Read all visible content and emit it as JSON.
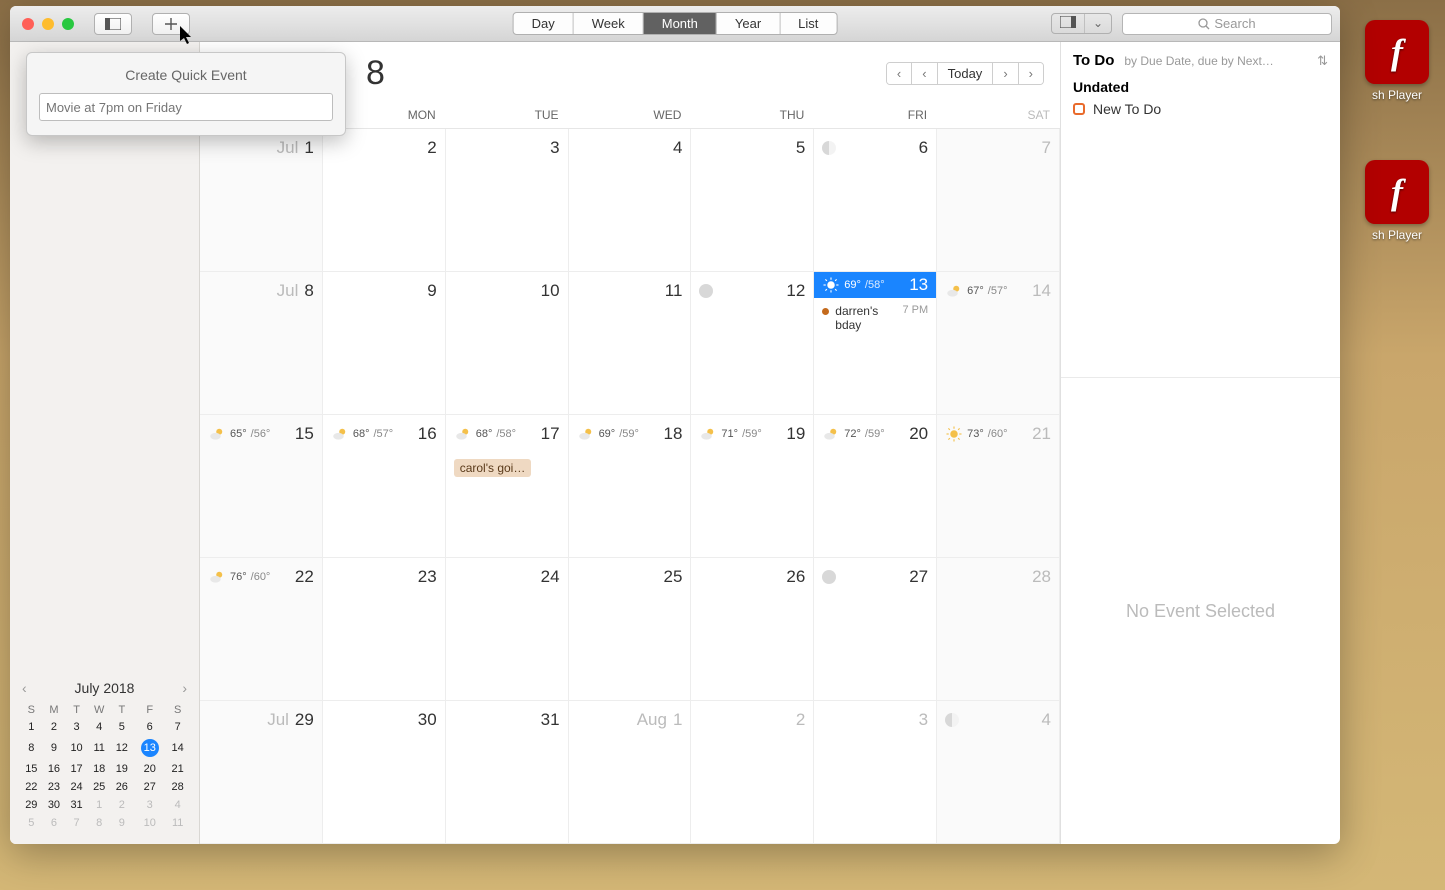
{
  "toolbar": {
    "views": [
      "Day",
      "Week",
      "Month",
      "Year",
      "List"
    ],
    "active_view": "Month",
    "search_placeholder": "Search"
  },
  "popover": {
    "title": "Create Quick Event",
    "placeholder": "Movie at 7pm on Friday"
  },
  "month_header": {
    "half_visible_digit": "8",
    "nav": {
      "today": "Today"
    }
  },
  "dow": [
    "MON",
    "TUE",
    "WED",
    "THU",
    "FRI",
    "SAT"
  ],
  "sunday_partial": "",
  "weeks": [
    [
      {
        "label": "Jul",
        "num": "1"
      },
      {
        "num": "2"
      },
      {
        "num": "3"
      },
      {
        "num": "4"
      },
      {
        "num": "5"
      },
      {
        "num": "6",
        "moon": "half"
      },
      {
        "num": "7",
        "sat": true
      }
    ],
    [
      {
        "label": "Jul",
        "num": "8"
      },
      {
        "num": "9"
      },
      {
        "num": "10"
      },
      {
        "num": "11"
      },
      {
        "num": "12",
        "moon": "full"
      },
      {
        "num": "13",
        "today": true,
        "weather": {
          "icon": "sun",
          "hi": "69°",
          "lo": "/58°"
        },
        "events": [
          {
            "title": "darren's bday",
            "time": "7 PM"
          }
        ]
      },
      {
        "num": "14",
        "sat": true,
        "weather": {
          "icon": "partly",
          "hi": "67°",
          "lo": "/57°"
        }
      }
    ],
    [
      {
        "num": "15",
        "weather": {
          "icon": "partly",
          "hi": "65°",
          "lo": "/56°"
        }
      },
      {
        "num": "16",
        "weather": {
          "icon": "partly",
          "hi": "68°",
          "lo": "/57°"
        }
      },
      {
        "num": "17",
        "weather": {
          "icon": "partly",
          "hi": "68°",
          "lo": "/58°"
        },
        "pill": "carol's goi…"
      },
      {
        "num": "18",
        "weather": {
          "icon": "partly",
          "hi": "69°",
          "lo": "/59°"
        }
      },
      {
        "num": "19",
        "weather": {
          "icon": "partly",
          "hi": "71°",
          "lo": "/59°"
        }
      },
      {
        "num": "20",
        "weather": {
          "icon": "partly",
          "hi": "72°",
          "lo": "/59°"
        }
      },
      {
        "num": "21",
        "sat": true,
        "weather": {
          "icon": "sun",
          "hi": "73°",
          "lo": "/60°"
        }
      }
    ],
    [
      {
        "num": "22",
        "weather": {
          "icon": "partly",
          "hi": "76°",
          "lo": "/60°"
        }
      },
      {
        "num": "23"
      },
      {
        "num": "24"
      },
      {
        "num": "25"
      },
      {
        "num": "26"
      },
      {
        "num": "27",
        "moon": "full"
      },
      {
        "num": "28",
        "sat": true
      }
    ],
    [
      {
        "label": "Jul",
        "num": "29"
      },
      {
        "num": "30"
      },
      {
        "num": "31"
      },
      {
        "label": "Aug",
        "num": "1",
        "dim": true
      },
      {
        "num": "2",
        "dim": true
      },
      {
        "num": "3",
        "dim": true
      },
      {
        "num": "4",
        "dim": true,
        "moon": "half",
        "sat": true
      }
    ]
  ],
  "mini": {
    "title": "July 2018",
    "dow": [
      "S",
      "M",
      "T",
      "W",
      "T",
      "F",
      "S"
    ],
    "rows": [
      [
        "1",
        "2",
        "3",
        "4",
        "5",
        "6",
        "7"
      ],
      [
        "8",
        "9",
        "10",
        "11",
        "12",
        "13",
        "14"
      ],
      [
        "15",
        "16",
        "17",
        "18",
        "19",
        "20",
        "21"
      ],
      [
        "22",
        "23",
        "24",
        "25",
        "26",
        "27",
        "28"
      ],
      [
        "29",
        "30",
        "31",
        "1",
        "2",
        "3",
        "4"
      ],
      [
        "5",
        "6",
        "7",
        "8",
        "9",
        "10",
        "11"
      ]
    ],
    "today": "13",
    "dim_start_row": 4,
    "dim_start_col": 3
  },
  "right": {
    "title": "To Do",
    "sub": "by Due Date, due by Next…",
    "section": "Undated",
    "item": "New To Do",
    "empty": "No Event Selected"
  },
  "desktop": {
    "label": "sh Player"
  }
}
